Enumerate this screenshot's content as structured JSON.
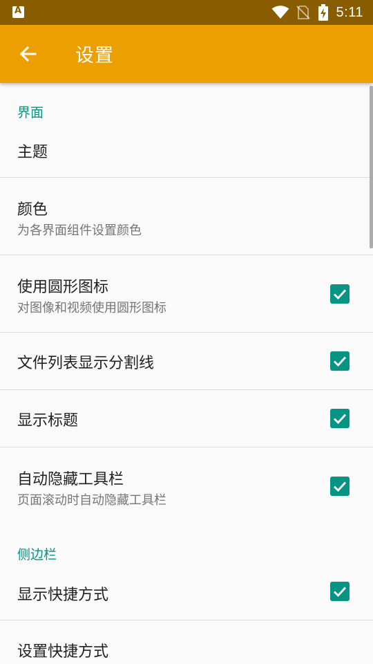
{
  "colors": {
    "status_bar": "#8a5c00",
    "app_bar": "#eb9f00",
    "accent": "#089484",
    "background": "#fafafa"
  },
  "status_bar": {
    "time": "5:11",
    "icons": [
      "app-notification-icon",
      "wifi-icon",
      "no-sim-icon",
      "battery-charging-icon"
    ]
  },
  "app_bar": {
    "title": "设置",
    "back_icon": "arrow-back-icon"
  },
  "sections": [
    {
      "header": "界面",
      "items": [
        {
          "title": "主题",
          "subtitle": "",
          "checkbox": null
        },
        {
          "title": "颜色",
          "subtitle": "为各界面组件设置颜色",
          "checkbox": null
        },
        {
          "title": "使用圆形图标",
          "subtitle": "对图像和视频使用圆形图标",
          "checkbox": true
        },
        {
          "title": "文件列表显示分割线",
          "subtitle": "",
          "checkbox": true
        },
        {
          "title": "显示标题",
          "subtitle": "",
          "checkbox": true
        },
        {
          "title": "自动隐藏工具栏",
          "subtitle": "页面滚动时自动隐藏工具栏",
          "checkbox": true
        }
      ]
    },
    {
      "header": "侧边栏",
      "items": [
        {
          "title": "显示快捷方式",
          "subtitle": "",
          "checkbox": true
        },
        {
          "title": "设置快捷方式",
          "subtitle": "",
          "checkbox": null
        }
      ]
    }
  ]
}
